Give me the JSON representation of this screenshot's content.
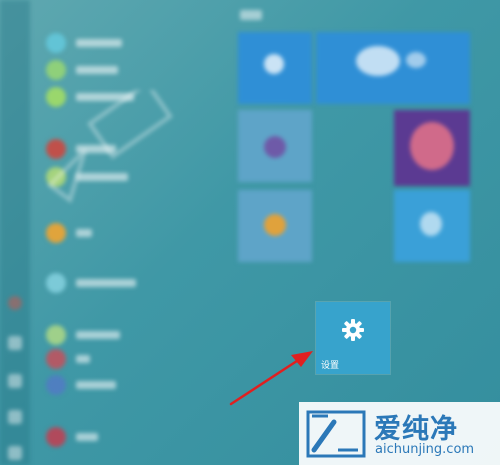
{
  "start_menu": {
    "settings_tile": {
      "label": "设置",
      "icon": "gear-icon",
      "color": "#37a3cc"
    }
  },
  "watermark": {
    "brand": "爱纯净",
    "url": "aichunjing.com",
    "color": "#2b78b8"
  },
  "annotation": {
    "arrow_color": "#e02020"
  },
  "colors": {
    "desktop_bg": "#3f98a6",
    "tile_blue": "#2f8fd6"
  }
}
